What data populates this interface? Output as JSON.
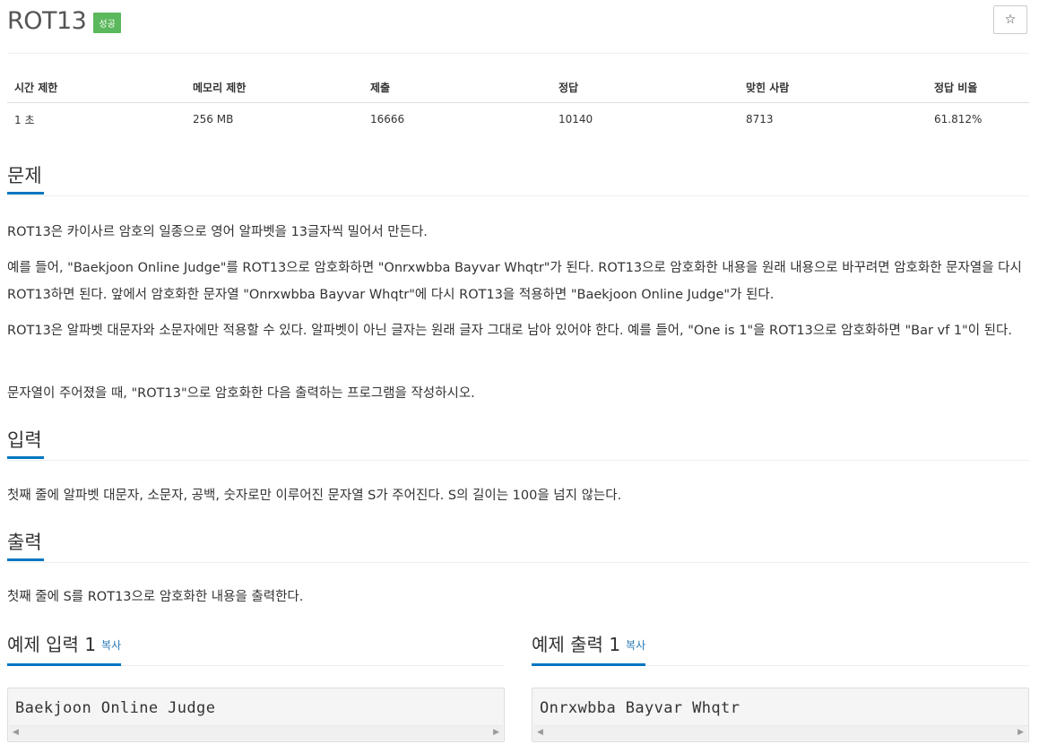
{
  "problem": {
    "title": "ROT13",
    "badge": "성공",
    "star": "☆"
  },
  "stats": {
    "headers": [
      "시간 제한",
      "메모리 제한",
      "제출",
      "정답",
      "맞힌 사람",
      "정답 비율"
    ],
    "values": [
      "1 초",
      "256 MB",
      "16666",
      "10140",
      "8713",
      "61.812%"
    ]
  },
  "sections": {
    "problem": {
      "heading": "문제",
      "paragraphs": [
        "ROT13은 카이사르 암호의 일종으로 영어 알파벳을 13글자씩 밀어서 만든다.",
        "예를 들어, \"Baekjoon Online Judge\"를 ROT13으로 암호화하면 \"Onrxwbba Bayvar Whqtr\"가 된다. ROT13으로 암호화한 내용을 원래 내용으로 바꾸려면 암호화한 문자열을 다시 ROT13하면 된다. 앞에서 암호화한 문자열 \"Onrxwbba Bayvar Whqtr\"에 다시 ROT13을 적용하면 \"Baekjoon Online Judge\"가 된다.",
        "ROT13은 알파벳 대문자와 소문자에만 적용할 수 있다. 알파벳이 아닌 글자는 원래 글자 그대로 남아 있어야 한다. 예를 들어, \"One is 1\"을 ROT13으로 암호화하면 \"Bar vf 1\"이 된다.",
        "문자열이 주어졌을 때, \"ROT13\"으로 암호화한 다음 출력하는 프로그램을 작성하시오."
      ]
    },
    "input": {
      "heading": "입력",
      "text": "첫째 줄에 알파벳 대문자, 소문자, 공백, 숫자로만 이루어진 문자열 S가 주어진다. S의 길이는 100을 넘지 않는다."
    },
    "output": {
      "heading": "출력",
      "text": "첫째 줄에 S를 ROT13으로 암호화한 내용을 출력한다."
    }
  },
  "examples": {
    "input": {
      "heading": "예제 입력 1",
      "copy": "복사",
      "code": "Baekjoon Online Judge"
    },
    "output": {
      "heading": "예제 출력 1",
      "copy": "복사",
      "code": "Onrxwbba Bayvar Whqtr"
    }
  }
}
